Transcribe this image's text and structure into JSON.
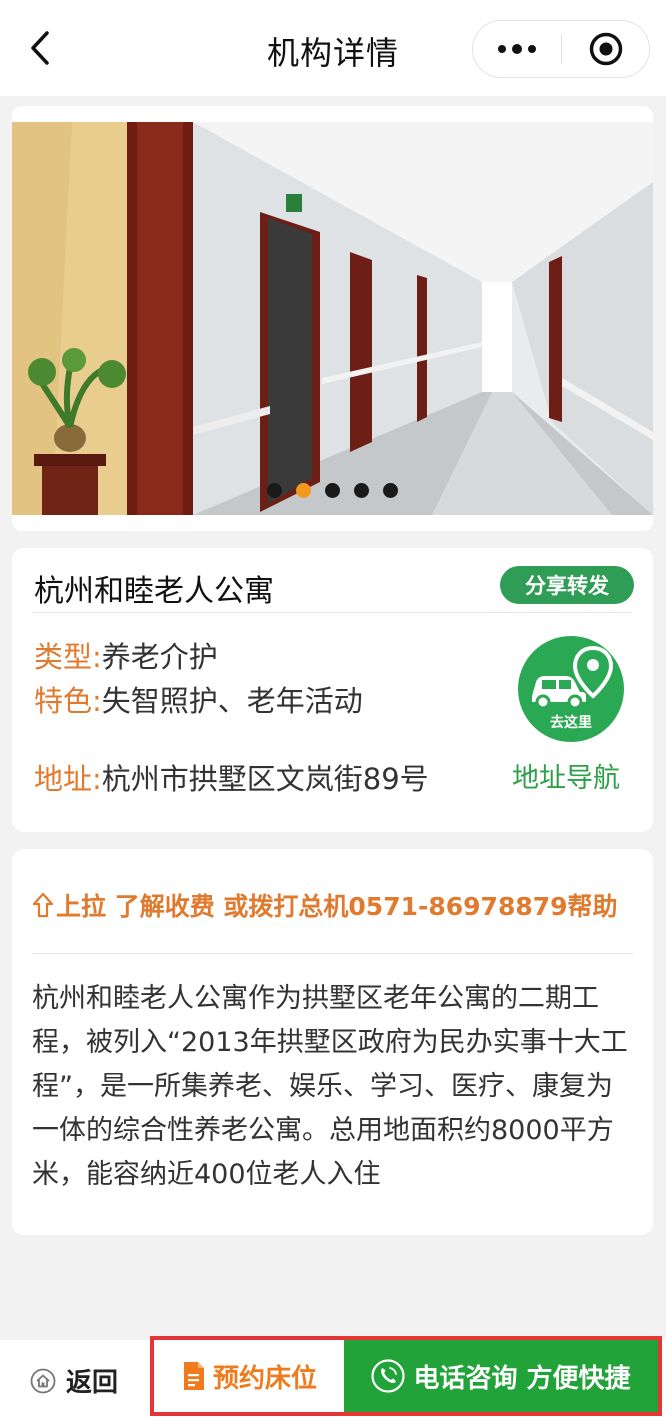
{
  "header": {
    "title": "机构详情"
  },
  "banner": {
    "slide_count": 5,
    "active_index": 1
  },
  "info": {
    "name": "杭州和睦老人公寓",
    "share_label": "分享转发",
    "type_key": "类型:",
    "type_value": "养老介护",
    "feature_key": "特色:",
    "feature_value": "失智照护、老年活动",
    "address_key": "地址:",
    "address_value": "杭州市拱墅区文岚街89号",
    "goto_label": "去这里",
    "nav_label": "地址导航"
  },
  "description": {
    "pull_tip": "上拉 了解收费 或拨打总机0571-86978879帮助",
    "text": "杭州和睦老人公寓作为拱墅区老年公寓的二期工程，被列入“2013年拱墅区政府为民办实事十大工程”，是一所集养老、娱乐、学习、医疗、康复为一体的综合性养老公寓。总用地面积约8000平方米，能容纳近400位老人入住"
  },
  "bottom": {
    "back_label": "返回",
    "book_label": "预约床位",
    "call_label": "电话咨询 方便快捷"
  },
  "colors": {
    "accent_orange": "#e07a2e",
    "brand_green": "#21a33a",
    "highlight_red": "#e43636"
  }
}
